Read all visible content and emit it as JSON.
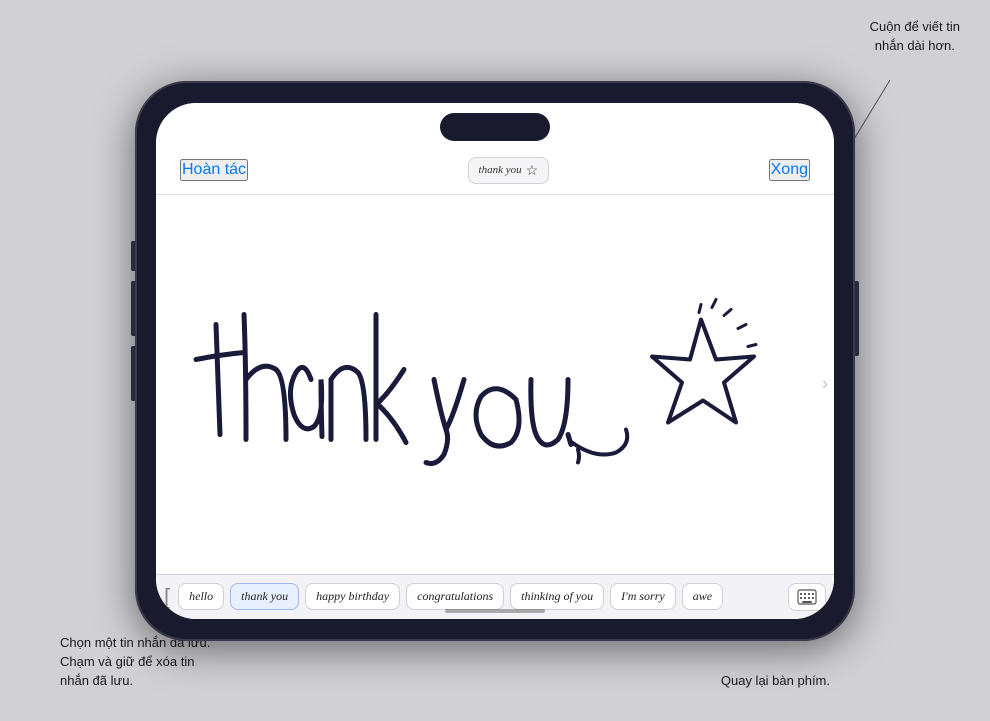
{
  "callouts": {
    "top_right": "Cuộn để viết tin\nnhắn dài hơn.",
    "bottom_left_line1": "Chọn một tin nhắn đã lưu.",
    "bottom_left_line2": "Chạm và giữ để xóa tin",
    "bottom_left_line3": "nhắn đã lưu.",
    "bottom_right": "Quay lại bàn phím."
  },
  "ui": {
    "undo_label": "Hoàn tác",
    "done_label": "Xong",
    "preview_text": "thank you",
    "chevron": "›",
    "tray_bracket": "[",
    "message_chips": [
      "hello",
      "thank you",
      "happy birthday",
      "congratulations",
      "thinking of you",
      "I'm sorry",
      "awe"
    ],
    "active_chip_index": 1
  },
  "colors": {
    "accent": "#007aff",
    "bg": "#ffffff",
    "tray_bg": "#f2f2f7",
    "border": "#d0d0d5",
    "ink": "#1a1a3a"
  }
}
